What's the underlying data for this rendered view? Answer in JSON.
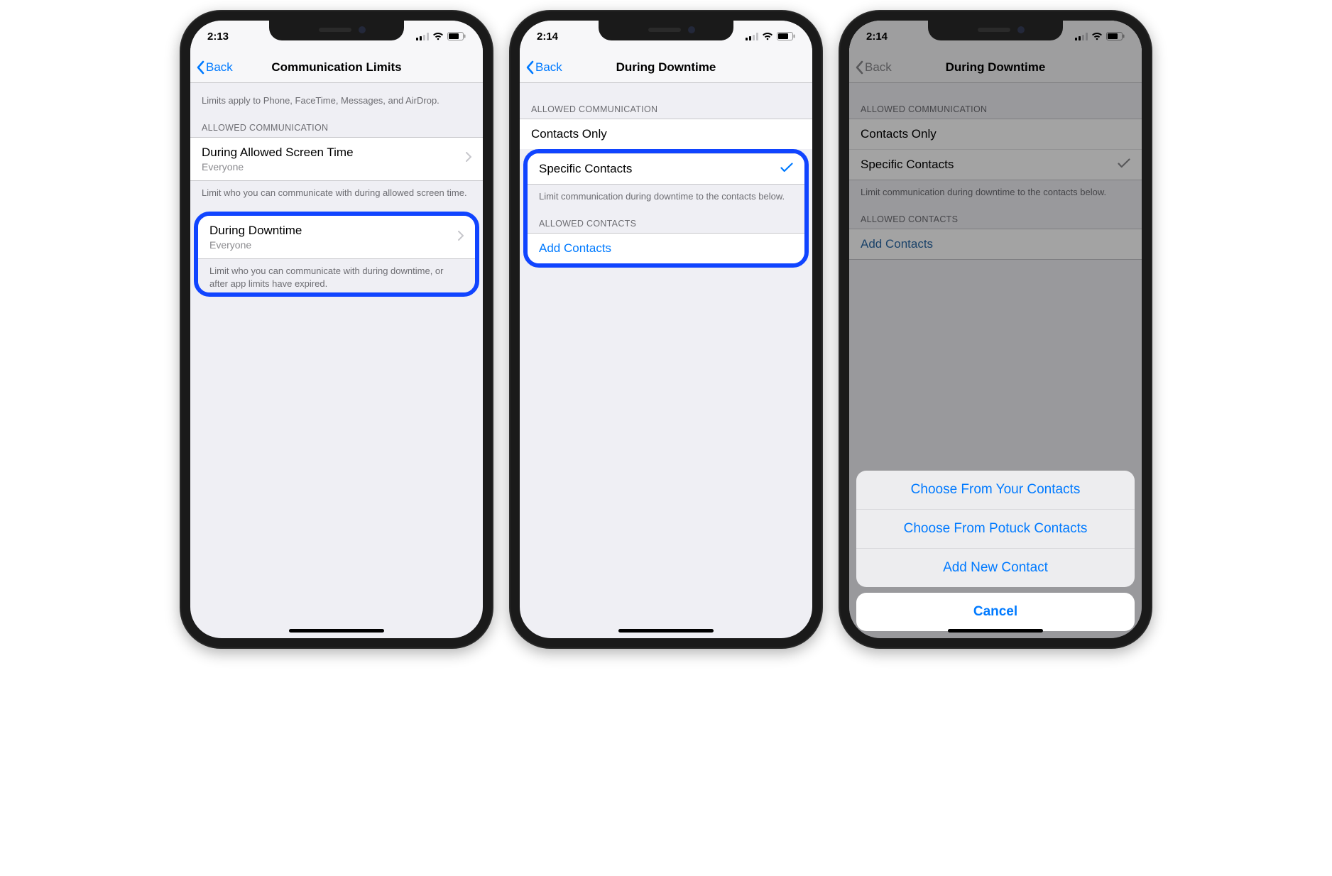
{
  "phones": [
    {
      "time": "2:13",
      "back": "Back",
      "title": "Communication Limits",
      "intro": "Limits apply to Phone, FaceTime, Messages, and AirDrop.",
      "section_header": "ALLOWED COMMUNICATION",
      "row1": {
        "title": "During Allowed Screen Time",
        "value": "Everyone"
      },
      "row1_footer": "Limit who you can communicate with during allowed screen time.",
      "row2": {
        "title": "During Downtime",
        "value": "Everyone"
      },
      "row2_footer": "Limit who you can communicate with during downtime, or after app limits have expired."
    },
    {
      "time": "2:14",
      "back": "Back",
      "title": "During Downtime",
      "section_header": "ALLOWED COMMUNICATION",
      "opt1": "Contacts Only",
      "opt2": "Specific Contacts",
      "opt_footer": "Limit communication during downtime to the contacts below.",
      "section2": "ALLOWED CONTACTS",
      "add": "Add Contacts"
    },
    {
      "time": "2:14",
      "back": "Back",
      "title": "During Downtime",
      "section_header": "ALLOWED COMMUNICATION",
      "opt1": "Contacts Only",
      "opt2": "Specific Contacts",
      "opt_footer": "Limit communication during downtime to the contacts below.",
      "section2": "ALLOWED CONTACTS",
      "add": "Add Contacts",
      "sheet": {
        "a1": "Choose From Your Contacts",
        "a2": "Choose From Potuck Contacts",
        "a3": "Add New Contact",
        "cancel": "Cancel"
      }
    }
  ]
}
